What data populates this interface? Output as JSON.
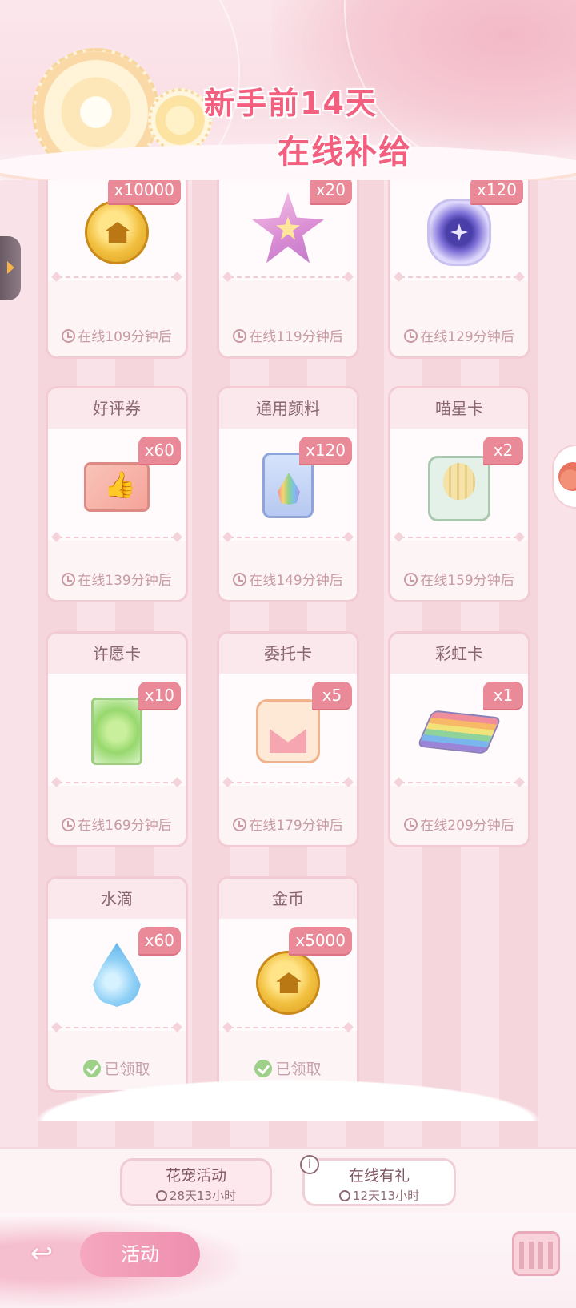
{
  "header": {
    "title_line1": "新手前14天",
    "title_line2": "在线补给"
  },
  "cards": [
    {
      "name": "",
      "badge": "x10000",
      "icon": "coin-icon",
      "status": "在线109分钟后",
      "claimed": false
    },
    {
      "name": "",
      "badge": "x20",
      "icon": "star-icon",
      "status": "在线119分钟后",
      "claimed": false
    },
    {
      "name": "",
      "badge": "x120",
      "icon": "crystal-icon",
      "status": "在线129分钟后",
      "claimed": false
    },
    {
      "name": "好评券",
      "badge": "x60",
      "icon": "thumbs-up-ticket-icon",
      "status": "在线139分钟后",
      "claimed": false
    },
    {
      "name": "通用颜料",
      "badge": "x120",
      "icon": "paint-bucket-icon",
      "status": "在线149分钟后",
      "claimed": false
    },
    {
      "name": "喵星卡",
      "badge": "x2",
      "icon": "hot-air-balloon-icon",
      "status": "在线159分钟后",
      "claimed": false
    },
    {
      "name": "许愿卡",
      "badge": "x10",
      "icon": "leaf-card-icon",
      "status": "在线169分钟后",
      "claimed": false
    },
    {
      "name": "委托卡",
      "badge": "x5",
      "icon": "envelope-icon",
      "status": "在线179分钟后",
      "claimed": false
    },
    {
      "name": "彩虹卡",
      "badge": "x1",
      "icon": "rainbow-tile-icon",
      "status": "在线209分钟后",
      "claimed": false
    },
    {
      "name": "水滴",
      "badge": "x60",
      "icon": "water-drop-icon",
      "status": "已领取",
      "claimed": true
    },
    {
      "name": "金币",
      "badge": "x5000",
      "icon": "coin-icon",
      "status": "已领取",
      "claimed": true
    }
  ],
  "tabs": [
    {
      "label": "花宠活动",
      "timer": "28天13小时"
    },
    {
      "label": "在线有礼",
      "timer": "12天13小时"
    }
  ],
  "bottom": {
    "activity_label": "活动"
  }
}
